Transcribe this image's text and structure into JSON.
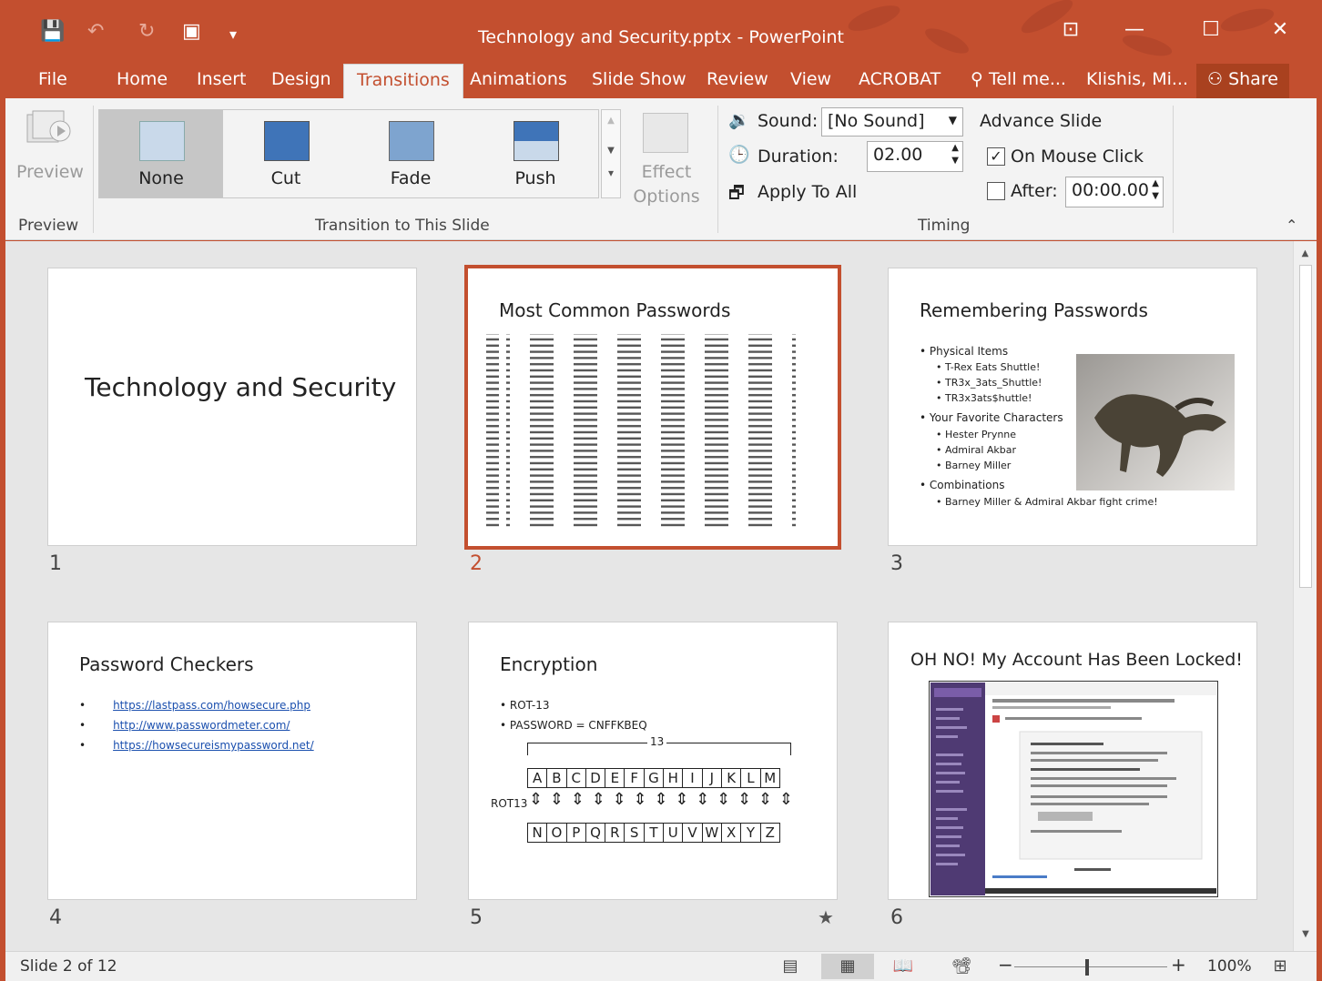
{
  "window": {
    "title": "Technology and Security.pptx - PowerPoint",
    "accent": "#c34f2f"
  },
  "tabs": [
    {
      "label": "File"
    },
    {
      "label": "Home"
    },
    {
      "label": "Insert"
    },
    {
      "label": "Design"
    },
    {
      "label": "Transitions",
      "active": true
    },
    {
      "label": "Animations"
    },
    {
      "label": "Slide Show"
    },
    {
      "label": "Review"
    },
    {
      "label": "View"
    },
    {
      "label": "ACROBAT"
    },
    {
      "label": "Tell me..."
    },
    {
      "label": "Klishis, Mi..."
    },
    {
      "label": "Share"
    }
  ],
  "ribbon": {
    "preview": {
      "button_label": "Preview",
      "group_label": "Preview"
    },
    "transitions": {
      "group_label": "Transition to This Slide",
      "items": [
        "None",
        "Cut",
        "Fade",
        "Push"
      ],
      "selected": "None",
      "effect_options": "Effect Options"
    },
    "timing": {
      "group_label": "Timing",
      "sound_label": "Sound:",
      "sound_value": "[No Sound]",
      "duration_label": "Duration:",
      "duration_value": "02.00",
      "apply_all": "Apply To All",
      "advance_title": "Advance Slide",
      "on_mouse_click": "On Mouse Click",
      "on_mouse_click_checked": true,
      "after_label": "After:",
      "after_checked": false,
      "after_value": "00:00.00"
    }
  },
  "slides": [
    {
      "num": "1",
      "title": "Technology and Security"
    },
    {
      "num": "2",
      "title": "Most Common Passwords",
      "selected": true
    },
    {
      "num": "3",
      "title": "Remembering Passwords",
      "bullets": [
        "• Physical Items",
        "• T-Rex Eats Shuttle!",
        "• TR3x_3ats_Shuttle!",
        "• TR3x3ats$huttle!",
        "• Your Favorite Characters",
        "• Hester Prynne",
        "• Admiral Akbar",
        "• Barney Miller",
        "• Combinations",
        "• Barney Miller & Admiral Akbar fight crime!"
      ]
    },
    {
      "num": "4",
      "title": "Password Checkers",
      "links": [
        "https://lastpass.com/howsecure.php",
        "http://www.passwordmeter.com/",
        "https://howsecureismypassword.net/"
      ]
    },
    {
      "num": "5",
      "title": "Encryption",
      "bullets": [
        "• ROT-13",
        "• PASSWORD = CNFFKBEQ"
      ],
      "rot_count": "13",
      "rot_label": "ROT13",
      "top_letters": [
        "A",
        "B",
        "C",
        "D",
        "E",
        "F",
        "G",
        "H",
        "I",
        "J",
        "K",
        "L",
        "M"
      ],
      "bottom_letters": [
        "N",
        "O",
        "P",
        "Q",
        "R",
        "S",
        "T",
        "U",
        "V",
        "W",
        "X",
        "Y",
        "Z"
      ]
    },
    {
      "num": "6",
      "title": "OH NO! My Account Has Been Locked!"
    }
  ],
  "status": {
    "slide_info": "Slide 2 of 12",
    "zoom": "100%"
  }
}
